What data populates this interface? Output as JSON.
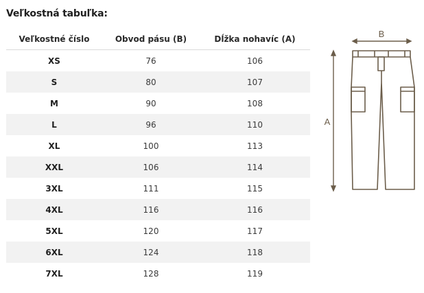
{
  "page": {
    "title": "Veľkostná tabuľka:"
  },
  "table": {
    "headers": [
      "Veľkostné číslo",
      "Obvod pásu (B)",
      "Dĺžka nohavíc (A)"
    ],
    "rows": [
      [
        "XS",
        "76",
        "106"
      ],
      [
        "S",
        "80",
        "107"
      ],
      [
        "M",
        "90",
        "108"
      ],
      [
        "L",
        "96",
        "110"
      ],
      [
        "XL",
        "100",
        "113"
      ],
      [
        "XXL",
        "106",
        "114"
      ],
      [
        "3XL",
        "111",
        "115"
      ],
      [
        "4XL",
        "116",
        "116"
      ],
      [
        "5XL",
        "120",
        "117"
      ],
      [
        "6XL",
        "124",
        "118"
      ],
      [
        "7XL",
        "128",
        "119"
      ]
    ]
  },
  "diagram": {
    "label_b": "B",
    "label_a": "A",
    "line_color": "#6b5d4a"
  }
}
